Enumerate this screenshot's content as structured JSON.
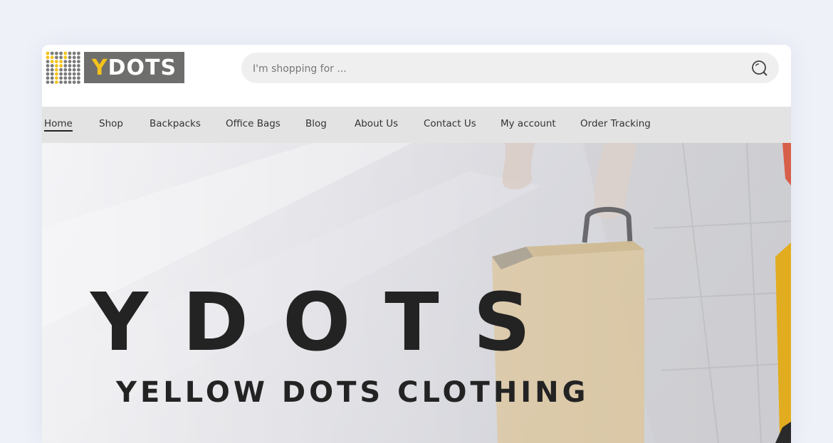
{
  "header": {
    "logo": {
      "text_y": "Y",
      "text_rest": "DOTS"
    },
    "search": {
      "placeholder": "I'm shopping for ..."
    },
    "search_icon": "search-icon"
  },
  "nav": {
    "items": [
      {
        "label": "Home",
        "active": true
      },
      {
        "label": "Shop"
      },
      {
        "label": "Backpacks"
      },
      {
        "label": "Office Bags"
      },
      {
        "label": "Blog"
      },
      {
        "label": "About Us"
      },
      {
        "label": "Contact Us"
      },
      {
        "label": "My account"
      },
      {
        "label": "Order Tracking"
      }
    ]
  },
  "hero": {
    "title": "YDOTS",
    "subtitle": "YELLOW DOTS CLOTHING"
  },
  "colors": {
    "page_bg": "#eef1f8",
    "nav_bg": "#e3e3e3",
    "brand_yellow": "#f3c21b",
    "brand_gray": "#6e6e6c",
    "text_dark": "#232323"
  }
}
